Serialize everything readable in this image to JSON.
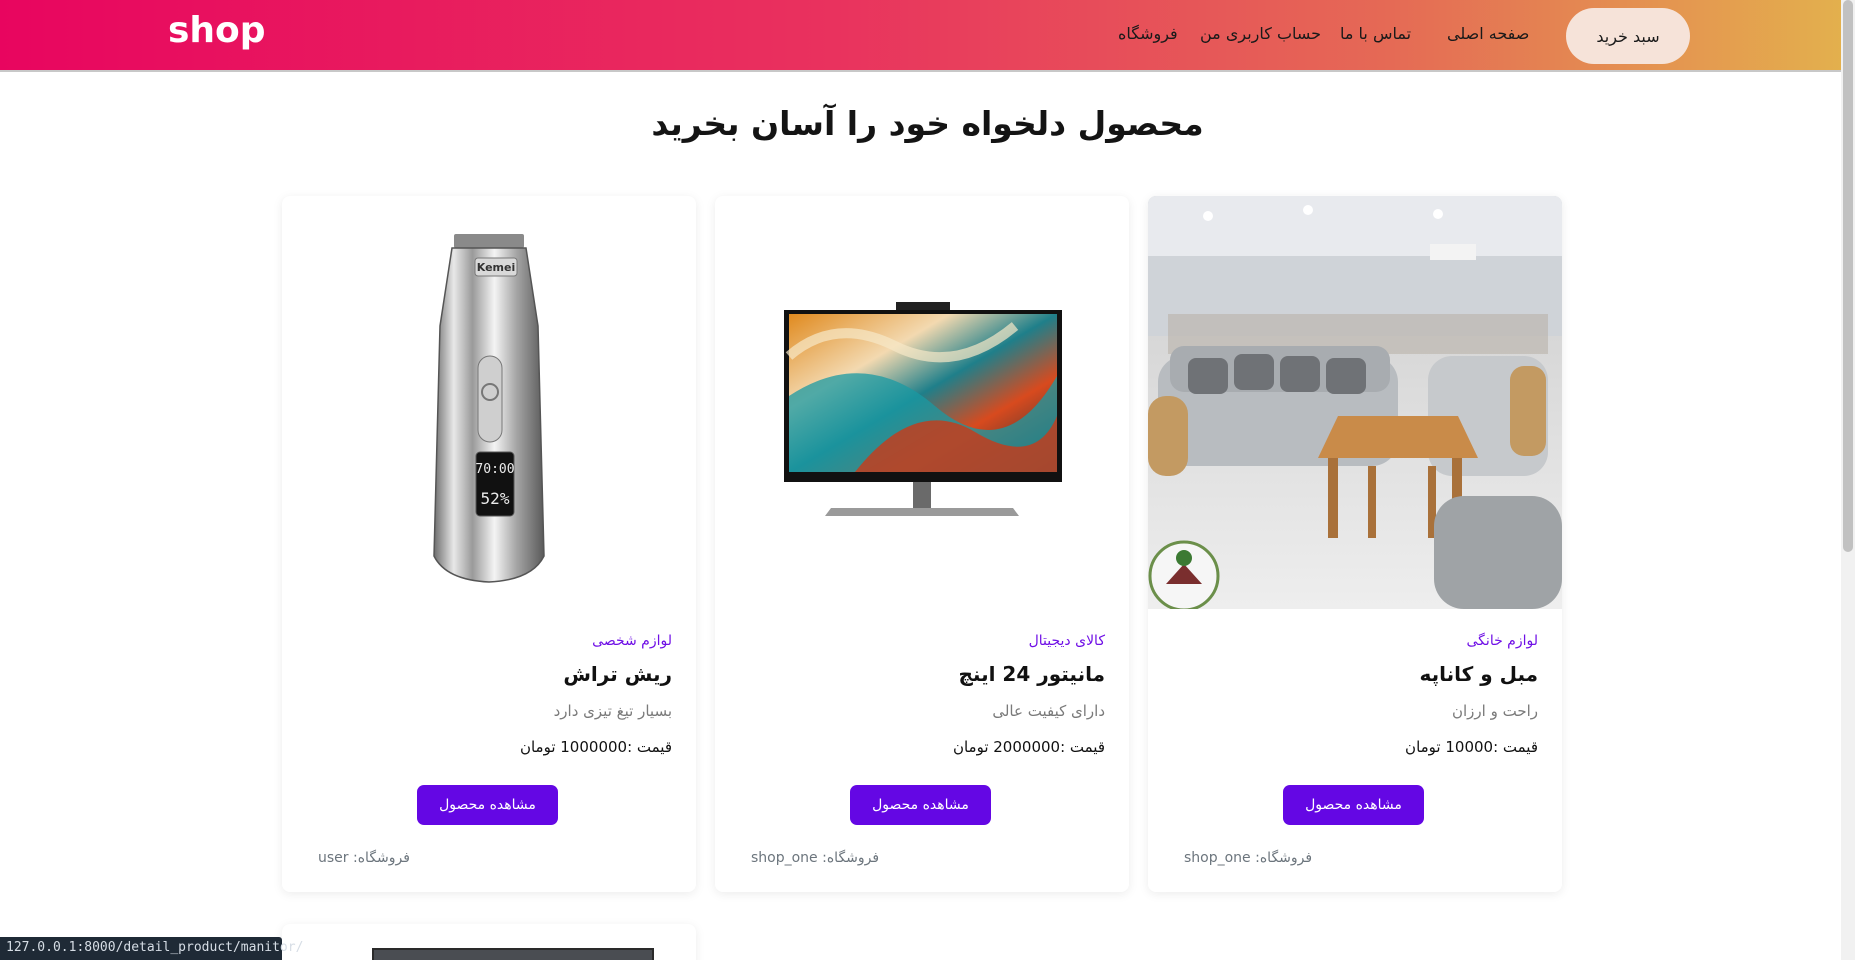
{
  "navbar": {
    "brand": "shop",
    "links": [
      "صفحه اصلی",
      "تماس با ما",
      "حساب کاربری من",
      "فروشگاه"
    ],
    "cart_label": "سبد خرید"
  },
  "page": {
    "title": "محصول دلخواه خود را آسان بخرید"
  },
  "products": [
    {
      "category": "لوازم خانگی",
      "title": "مبل و کاناپه",
      "description": "راحت و ارزان",
      "price": "قیمت :10000 تومان",
      "button": "مشاهده محصول",
      "seller": "فروشگاه: shop_one"
    },
    {
      "category": "کالای دیجیتال",
      "title": "مانیتور 24 اینچ",
      "description": "دارای کیفیت عالی",
      "price": "قیمت :2000000 تومان",
      "button": "مشاهده محصول",
      "seller": "فروشگاه: shop_one"
    },
    {
      "category": "لوازم شخصی",
      "title": "ریش تراش",
      "description": "بسیار تیغ تیزی دارد",
      "price": "قیمت :1000000 تومان",
      "button": "مشاهده محصول",
      "seller": "فروشگاه: user"
    }
  ],
  "trimmer_display": {
    "time": "70:00",
    "battery": "52%",
    "brand": "Kemei"
  },
  "status_url": "127.0.0.1:8000/detail_product/manitor/",
  "colors": {
    "accent": "#6407e4",
    "category": "#6f0fe6",
    "nav_start": "#e8055f",
    "nav_end": "#e3b24d"
  }
}
